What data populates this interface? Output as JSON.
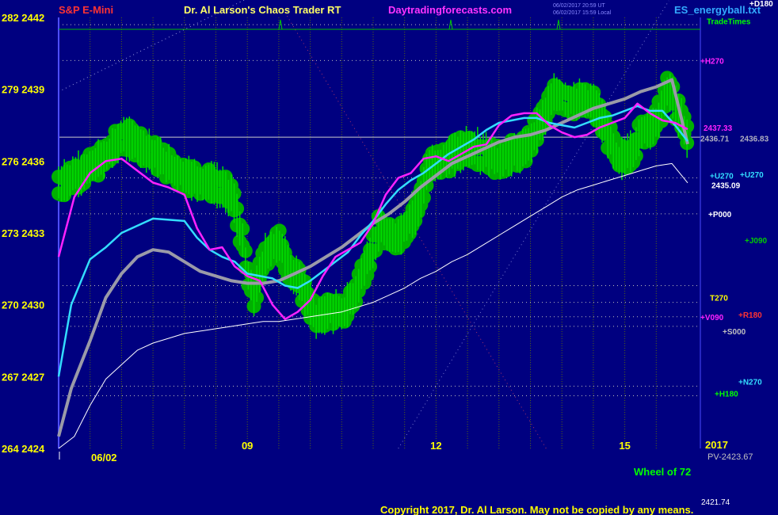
{
  "header": {
    "instrument": "S&P E-Mini",
    "title": "Dr. Al Larson's Chaos Trader RT",
    "website": "Daytradingforecasts.com",
    "timestamp_line1": "06/02/2017 20:59 UT",
    "timestamp_line2": "06/02/2017 15:59 Local",
    "filename": "ES_energyball.txt"
  },
  "footer": {
    "date_label": "06/02",
    "year": "2017",
    "pv": "PV-2423.67",
    "wheel": "Wheel of 72",
    "copyright": "Copyright 2017, Dr. Al Larson. May not be copied by any means.",
    "bottom_value": "2421.74"
  },
  "colors": {
    "background": "#000080",
    "price_bars": "#00dd00",
    "energy_balls": "#00b000",
    "magenta_ma": "#ff22ff",
    "cyan_ma": "#33ddff",
    "gray_ma": "#9a9aa8",
    "white_ma": "#ffffff"
  },
  "chart_data": {
    "type": "line",
    "title": "S&P E-Mini",
    "y_left_labels": [
      {
        "deg": "282",
        "price": "2442",
        "v": 2442
      },
      {
        "deg": "279",
        "price": "2439",
        "v": 2439
      },
      {
        "deg": "276",
        "price": "2436",
        "v": 2436
      },
      {
        "deg": "273",
        "price": "2433",
        "v": 2433
      },
      {
        "deg": "270",
        "price": "2430",
        "v": 2430
      },
      {
        "deg": "267",
        "price": "2427",
        "v": 2427
      },
      {
        "deg": "264",
        "price": "2424",
        "v": 2424
      }
    ],
    "ylim": [
      2424,
      2442
    ],
    "x_ticks": [
      {
        "label": "09",
        "h": 9
      },
      {
        "label": "12",
        "h": 12
      },
      {
        "label": "15",
        "h": 15
      }
    ],
    "x_range_hours": [
      6.0,
      16.0
    ],
    "trade_times_label": "TradeTimes",
    "last_values": {
      "magenta": "2437.33",
      "gray_top": "2436.71",
      "cyan": "2436.83",
      "white": "2435.09"
    },
    "series": [
      {
        "name": "price",
        "points": [
          [
            6.0,
            2435.0
          ],
          [
            6.25,
            2435.4
          ],
          [
            6.5,
            2435.7
          ],
          [
            6.75,
            2436.2
          ],
          [
            7.0,
            2437.0
          ],
          [
            7.25,
            2436.8
          ],
          [
            7.5,
            2436.3
          ],
          [
            7.75,
            2435.8
          ],
          [
            8.0,
            2435.4
          ],
          [
            8.25,
            2435.2
          ],
          [
            8.5,
            2435.0
          ],
          [
            8.75,
            2434.6
          ],
          [
            8.9,
            2433.0
          ],
          [
            9.0,
            2431.3
          ],
          [
            9.1,
            2430.3
          ],
          [
            9.3,
            2432.2
          ],
          [
            9.5,
            2432.6
          ],
          [
            9.7,
            2431.4
          ],
          [
            9.9,
            2430.6
          ],
          [
            10.1,
            2429.4
          ],
          [
            10.3,
            2429.8
          ],
          [
            10.5,
            2429.6
          ],
          [
            10.7,
            2430.4
          ],
          [
            10.9,
            2431.8
          ],
          [
            11.1,
            2433.2
          ],
          [
            11.3,
            2432.7
          ],
          [
            11.5,
            2433.2
          ],
          [
            11.7,
            2434.0
          ],
          [
            11.9,
            2435.8
          ],
          [
            12.1,
            2436.0
          ],
          [
            12.3,
            2436.3
          ],
          [
            12.5,
            2436.6
          ],
          [
            12.8,
            2436.3
          ],
          [
            13.0,
            2436.0
          ],
          [
            13.2,
            2436.3
          ],
          [
            13.4,
            2436.4
          ],
          [
            13.6,
            2437.3
          ],
          [
            13.9,
            2438.8
          ],
          [
            14.2,
            2438.5
          ],
          [
            14.5,
            2438.4
          ],
          [
            14.7,
            2437.3
          ],
          [
            14.9,
            2436.0
          ],
          [
            15.1,
            2436.4
          ],
          [
            15.3,
            2437.3
          ],
          [
            15.5,
            2437.6
          ],
          [
            15.7,
            2439.1
          ],
          [
            15.85,
            2438.0
          ],
          [
            16.0,
            2437.0
          ]
        ]
      },
      {
        "name": "magenta",
        "points": [
          [
            6.0,
            2432.0
          ],
          [
            6.25,
            2434.5
          ],
          [
            6.5,
            2435.5
          ],
          [
            6.75,
            2436.0
          ],
          [
            7.0,
            2436.1
          ],
          [
            7.25,
            2435.6
          ],
          [
            7.5,
            2435.1
          ],
          [
            7.75,
            2434.9
          ],
          [
            8.0,
            2434.6
          ],
          [
            8.2,
            2433.2
          ],
          [
            8.4,
            2432.3
          ],
          [
            8.6,
            2432.4
          ],
          [
            8.8,
            2431.6
          ],
          [
            9.0,
            2431.2
          ],
          [
            9.2,
            2431.0
          ],
          [
            9.4,
            2430.0
          ],
          [
            9.6,
            2429.4
          ],
          [
            9.8,
            2429.7
          ],
          [
            10.0,
            2430.2
          ],
          [
            10.2,
            2431.2
          ],
          [
            10.4,
            2432.0
          ],
          [
            10.6,
            2432.3
          ],
          [
            10.8,
            2432.6
          ],
          [
            11.0,
            2433.4
          ],
          [
            11.2,
            2434.6
          ],
          [
            11.4,
            2435.3
          ],
          [
            11.6,
            2435.5
          ],
          [
            11.8,
            2436.1
          ],
          [
            12.0,
            2436.2
          ],
          [
            12.2,
            2436.0
          ],
          [
            12.4,
            2436.3
          ],
          [
            12.6,
            2436.6
          ],
          [
            12.8,
            2436.7
          ],
          [
            13.0,
            2437.5
          ],
          [
            13.2,
            2437.9
          ],
          [
            13.4,
            2438.0
          ],
          [
            13.6,
            2438.0
          ],
          [
            13.8,
            2437.5
          ],
          [
            14.0,
            2437.2
          ],
          [
            14.2,
            2437.0
          ],
          [
            14.4,
            2437.1
          ],
          [
            14.6,
            2437.4
          ],
          [
            14.8,
            2437.6
          ],
          [
            15.0,
            2437.8
          ],
          [
            15.2,
            2438.4
          ],
          [
            15.4,
            2438.0
          ],
          [
            15.6,
            2437.7
          ],
          [
            15.8,
            2437.6
          ],
          [
            16.0,
            2437.33
          ]
        ]
      },
      {
        "name": "cyan",
        "points": [
          [
            6.0,
            2427.0
          ],
          [
            6.2,
            2430.0
          ],
          [
            6.5,
            2431.9
          ],
          [
            6.75,
            2432.4
          ],
          [
            7.0,
            2433.0
          ],
          [
            7.5,
            2433.6
          ],
          [
            8.0,
            2433.5
          ],
          [
            8.2,
            2432.8
          ],
          [
            8.4,
            2432.3
          ],
          [
            8.6,
            2432.0
          ],
          [
            8.8,
            2431.8
          ],
          [
            9.0,
            2431.3
          ],
          [
            9.2,
            2431.2
          ],
          [
            9.4,
            2431.1
          ],
          [
            9.6,
            2430.8
          ],
          [
            9.8,
            2430.7
          ],
          [
            10.0,
            2431.0
          ],
          [
            10.2,
            2431.4
          ],
          [
            10.4,
            2431.8
          ],
          [
            10.6,
            2432.2
          ],
          [
            10.8,
            2432.9
          ],
          [
            11.0,
            2433.5
          ],
          [
            11.2,
            2434.2
          ],
          [
            11.4,
            2434.8
          ],
          [
            11.6,
            2435.2
          ],
          [
            11.8,
            2435.5
          ],
          [
            12.0,
            2435.9
          ],
          [
            12.2,
            2436.3
          ],
          [
            12.4,
            2436.6
          ],
          [
            12.6,
            2436.9
          ],
          [
            12.8,
            2437.3
          ],
          [
            13.0,
            2437.6
          ],
          [
            13.2,
            2437.7
          ],
          [
            13.4,
            2437.8
          ],
          [
            13.6,
            2437.8
          ],
          [
            13.8,
            2437.6
          ],
          [
            14.0,
            2437.5
          ],
          [
            14.2,
            2437.4
          ],
          [
            14.4,
            2437.6
          ],
          [
            14.6,
            2437.8
          ],
          [
            14.8,
            2437.9
          ],
          [
            15.0,
            2438.1
          ],
          [
            15.2,
            2438.3
          ],
          [
            15.4,
            2438.1
          ],
          [
            15.6,
            2438.1
          ],
          [
            15.8,
            2437.5
          ],
          [
            16.0,
            2436.83
          ]
        ]
      },
      {
        "name": "gray",
        "points": [
          [
            6.0,
            2424.5
          ],
          [
            6.2,
            2426.5
          ],
          [
            6.5,
            2428.5
          ],
          [
            6.75,
            2430.3
          ],
          [
            7.0,
            2431.3
          ],
          [
            7.25,
            2432.0
          ],
          [
            7.5,
            2432.3
          ],
          [
            7.75,
            2432.2
          ],
          [
            8.0,
            2431.8
          ],
          [
            8.25,
            2431.4
          ],
          [
            8.5,
            2431.2
          ],
          [
            8.75,
            2431.0
          ],
          [
            9.0,
            2430.9
          ],
          [
            9.25,
            2430.9
          ],
          [
            9.5,
            2431.0
          ],
          [
            9.75,
            2431.3
          ],
          [
            10.0,
            2431.6
          ],
          [
            10.25,
            2432.0
          ],
          [
            10.5,
            2432.4
          ],
          [
            10.75,
            2432.9
          ],
          [
            11.0,
            2433.4
          ],
          [
            11.25,
            2433.8
          ],
          [
            11.5,
            2434.3
          ],
          [
            11.75,
            2434.9
          ],
          [
            12.0,
            2435.4
          ],
          [
            12.25,
            2435.9
          ],
          [
            12.5,
            2436.2
          ],
          [
            12.75,
            2436.5
          ],
          [
            13.0,
            2436.8
          ],
          [
            13.25,
            2437.0
          ],
          [
            13.5,
            2437.1
          ],
          [
            13.75,
            2437.3
          ],
          [
            14.0,
            2437.6
          ],
          [
            14.25,
            2437.9
          ],
          [
            14.5,
            2438.2
          ],
          [
            14.75,
            2438.4
          ],
          [
            15.0,
            2438.6
          ],
          [
            15.25,
            2438.9
          ],
          [
            15.5,
            2439.1
          ],
          [
            15.75,
            2439.4
          ],
          [
            16.0,
            2436.71
          ]
        ]
      },
      {
        "name": "white",
        "points": [
          [
            6.0,
            2424.0
          ],
          [
            6.25,
            2424.5
          ],
          [
            6.5,
            2425.8
          ],
          [
            6.75,
            2426.9
          ],
          [
            7.0,
            2427.5
          ],
          [
            7.25,
            2428.1
          ],
          [
            7.5,
            2428.4
          ],
          [
            7.75,
            2428.6
          ],
          [
            8.0,
            2428.8
          ],
          [
            8.25,
            2428.9
          ],
          [
            8.5,
            2429.0
          ],
          [
            8.75,
            2429.1
          ],
          [
            9.0,
            2429.2
          ],
          [
            9.25,
            2429.3
          ],
          [
            9.5,
            2429.3
          ],
          [
            9.75,
            2429.4
          ],
          [
            10.0,
            2429.5
          ],
          [
            10.25,
            2429.6
          ],
          [
            10.5,
            2429.7
          ],
          [
            10.75,
            2429.9
          ],
          [
            11.0,
            2430.1
          ],
          [
            11.25,
            2430.4
          ],
          [
            11.5,
            2430.7
          ],
          [
            11.75,
            2431.1
          ],
          [
            12.0,
            2431.4
          ],
          [
            12.25,
            2431.8
          ],
          [
            12.5,
            2432.1
          ],
          [
            12.75,
            2432.5
          ],
          [
            13.0,
            2432.9
          ],
          [
            13.25,
            2433.3
          ],
          [
            13.5,
            2433.7
          ],
          [
            13.75,
            2434.1
          ],
          [
            14.0,
            2434.5
          ],
          [
            14.25,
            2434.8
          ],
          [
            14.5,
            2435.0
          ],
          [
            14.75,
            2435.2
          ],
          [
            15.0,
            2435.4
          ],
          [
            15.25,
            2435.6
          ],
          [
            15.5,
            2435.8
          ],
          [
            15.75,
            2435.9
          ],
          [
            16.0,
            2435.09
          ]
        ]
      }
    ],
    "horizontal_lines": [
      {
        "v": 2441.7,
        "color": "#bbbbbb",
        "dash": "1,4"
      },
      {
        "v": 2440.2,
        "color": "#bbbbbb",
        "dash": "1,4"
      },
      {
        "v": 2437.0,
        "color": "#cccccc",
        "dash": ""
      },
      {
        "v": 2435.3,
        "color": "#bbbbbb",
        "dash": "1,4"
      },
      {
        "v": 2434.7,
        "color": "#bbbbbb",
        "dash": "1,4"
      },
      {
        "v": 2433.8,
        "color": "#bbbbbb",
        "dash": "1,4"
      },
      {
        "v": 2430.8,
        "color": "#bbbbbb",
        "dash": "1,4"
      },
      {
        "v": 2430.1,
        "color": "#bbbbbb",
        "dash": "1,4"
      },
      {
        "v": 2429.5,
        "color": "#bbbbbb",
        "dash": "1,4"
      },
      {
        "v": 2429.1,
        "color": "#bbbbbb",
        "dash": "1,4"
      },
      {
        "v": 2426.6,
        "color": "#bbbbbb",
        "dash": "1,4"
      },
      {
        "v": 2426.2,
        "color": "#bbbbbb",
        "dash": "1,4"
      }
    ],
    "right_labels": [
      {
        "text": "+D180",
        "v": 2442.6,
        "color": "#ffffff",
        "dx": 62
      },
      {
        "text": "TradeTimes",
        "v": 2441.85,
        "color": "#00ff00",
        "dx": 8
      },
      {
        "text": "+H270",
        "v": 2440.2,
        "color": "#ff22ff",
        "dx": 0
      },
      {
        "text": "2437.33",
        "v": 2437.4,
        "color": "#ff22ff",
        "dx": 4
      },
      {
        "text": "2436.71",
        "v": 2436.95,
        "color": "#b0b0c0",
        "dx": 0
      },
      {
        "text": "2436.83",
        "v": 2436.95,
        "color": "#b0b0c0",
        "dx": 50
      },
      {
        "text": "+U270",
        "v": 2435.4,
        "color": "#33ddff",
        "dx": 12
      },
      {
        "text": "+U270",
        "v": 2435.45,
        "color": "#33ddff",
        "dx": 50
      },
      {
        "text": "2435.09",
        "v": 2435.0,
        "color": "#ffffff",
        "dx": 14
      },
      {
        "text": "+P000",
        "v": 2433.8,
        "color": "#ffffff",
        "dx": 10
      },
      {
        "text": "+J090",
        "v": 2432.7,
        "color": "#00cc00",
        "dx": 56
      },
      {
        "text": "T270",
        "v": 2430.3,
        "color": "#ffff00",
        "dx": 12
      },
      {
        "text": "+R180",
        "v": 2429.6,
        "color": "#ff3333",
        "dx": 48
      },
      {
        "text": "+V090",
        "v": 2429.5,
        "color": "#ff22ff",
        "dx": 0
      },
      {
        "text": "+S000",
        "v": 2428.9,
        "color": "#c0c0c0",
        "dx": 28
      },
      {
        "text": "+N270",
        "v": 2426.8,
        "color": "#33ddff",
        "dx": 48
      },
      {
        "text": "+H180",
        "v": 2426.3,
        "color": "#00ff00",
        "dx": 18
      }
    ],
    "dotted_diagonals": [
      {
        "from": [
          6.0,
          2438.9
        ],
        "to": [
          10.7,
          2445.0
        ],
        "color": "#9999dd"
      },
      {
        "from": [
          9.6,
          2442.2
        ],
        "to": [
          13.75,
          2424.0
        ],
        "color": "#aa3366"
      },
      {
        "from": [
          11.4,
          2424.0
        ],
        "to": [
          15.7,
          2442.7
        ],
        "color": "#7777cc"
      }
    ]
  }
}
